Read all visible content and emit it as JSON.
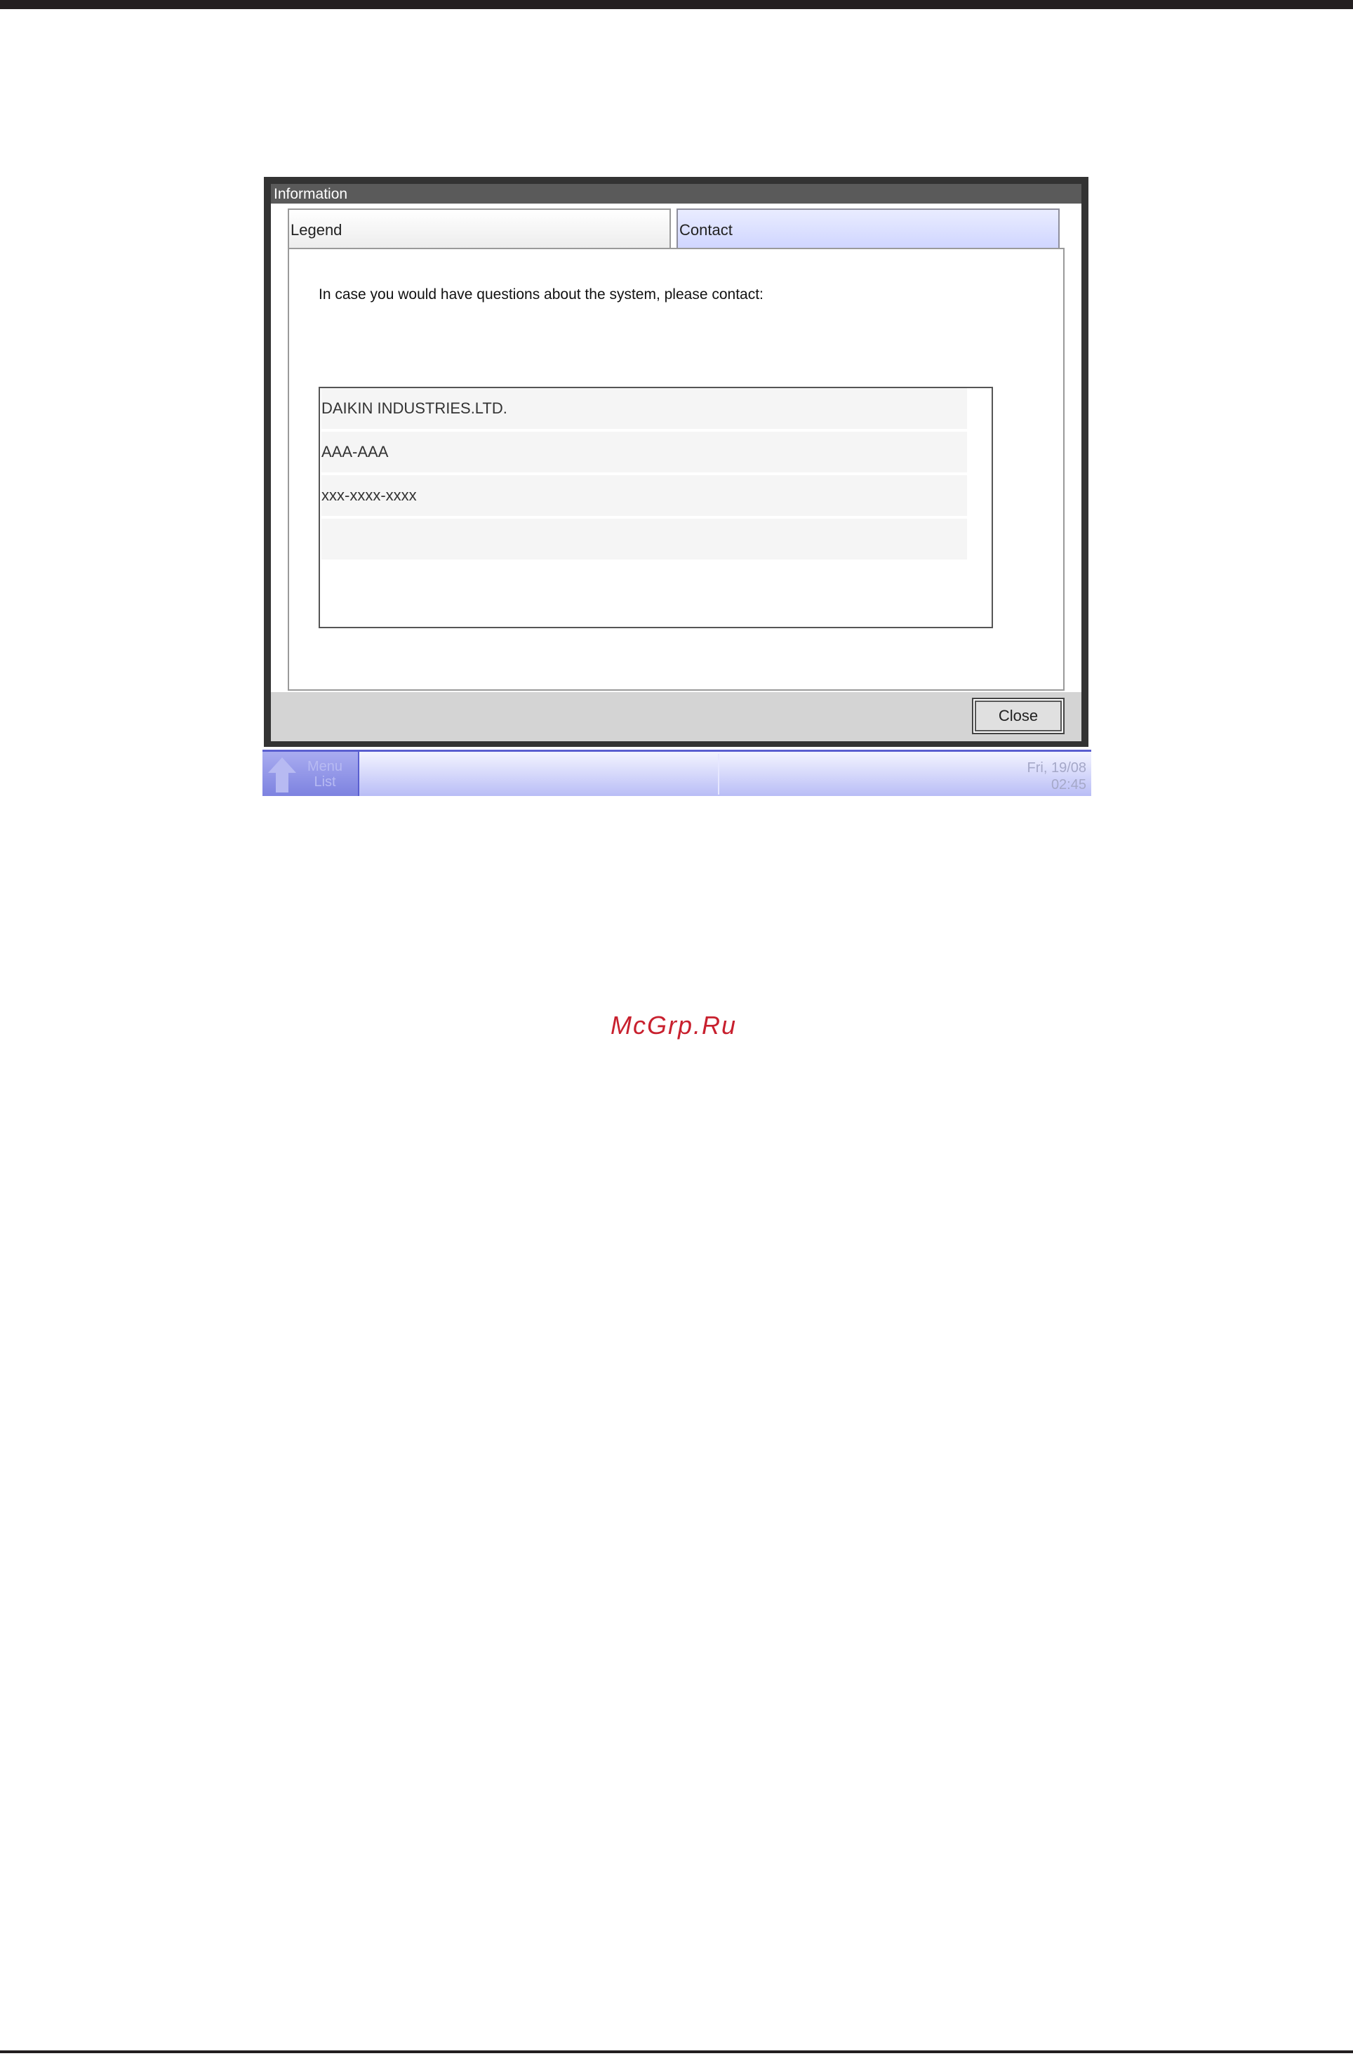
{
  "dialog": {
    "title": "Information",
    "tabs": [
      {
        "label": "Legend",
        "selected": false
      },
      {
        "label": "Contact",
        "selected": true
      }
    ],
    "message": "In case you would have questions about the system, please contact:",
    "contact_rows": [
      "DAIKIN INDUSTRIES.LTD.",
      "AAA-AAA",
      "xxx-xxxx-xxxx",
      ""
    ],
    "close_label": "Close"
  },
  "statusbar": {
    "menu_label_line1": "Menu",
    "menu_label_line2": "List",
    "date": "Fri, 19/08",
    "time": "02:45"
  },
  "watermark": "McGrp.Ru",
  "colors": {
    "accent": "#5a5fd0",
    "tab_selected": "#cfd5ff",
    "title_bar": "#5a5a5a",
    "watermark": "#c8202e"
  }
}
